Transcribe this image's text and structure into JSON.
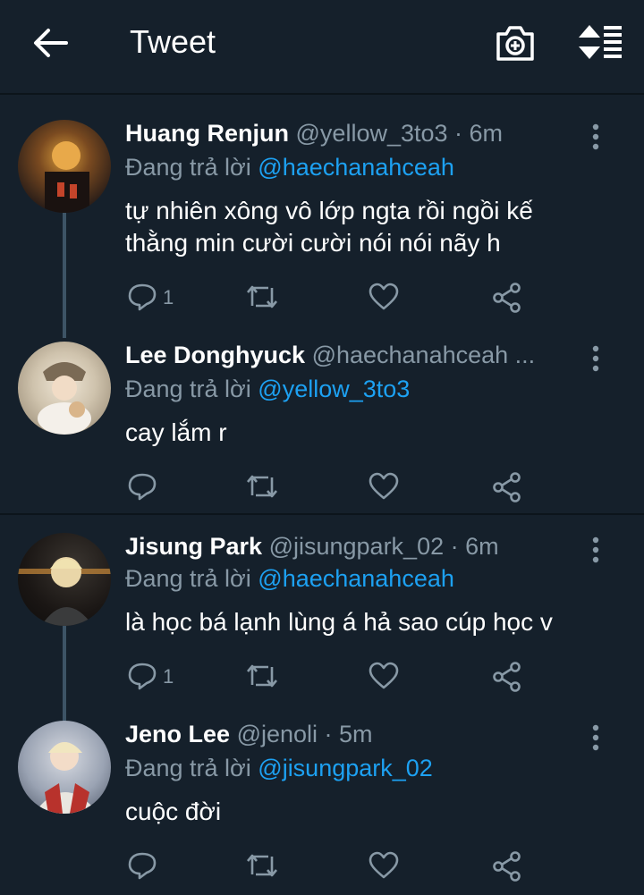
{
  "header": {
    "title": "Tweet",
    "back_icon": "arrow-left-icon",
    "camera_icon": "camera-add-icon",
    "sort_icon": "sort-icon"
  },
  "colors": {
    "background": "#15202b",
    "accent": "#1da1f2",
    "muted": "#8899a6",
    "thread_line": "#3d5466"
  },
  "tweets": [
    {
      "name": "Huang Renjun",
      "meta": "@yellow_3to3 · 6m",
      "reply_prefix": "Đang trả lời",
      "reply_to": "@haechanahceah",
      "lines": [
        "tự nhiên xông vô lớp ngta rồi ngồi kế",
        "thằng min cười cười nói nói nãy h"
      ],
      "reply_count": "1"
    },
    {
      "name": "Lee Donghyuck",
      "meta": "@haechanahceah ...",
      "reply_prefix": "Đang trả lời",
      "reply_to": "@yellow_3to3",
      "lines": [
        "cay lắm r"
      ],
      "reply_count": ""
    },
    {
      "name": "Jisung Park",
      "meta": "@jisungpark_02 · 6m",
      "reply_prefix": "Đang trả lời",
      "reply_to": "@haechanahceah",
      "lines": [
        "là học bá lạnh lùng á hả sao cúp học v"
      ],
      "reply_count": "1"
    },
    {
      "name": "Jeno Lee",
      "meta": "@jenoli · 5m",
      "reply_prefix": "Đang trả lời",
      "reply_to": "@jisungpark_02",
      "lines": [
        "cuộc đời"
      ],
      "reply_count": ""
    }
  ]
}
